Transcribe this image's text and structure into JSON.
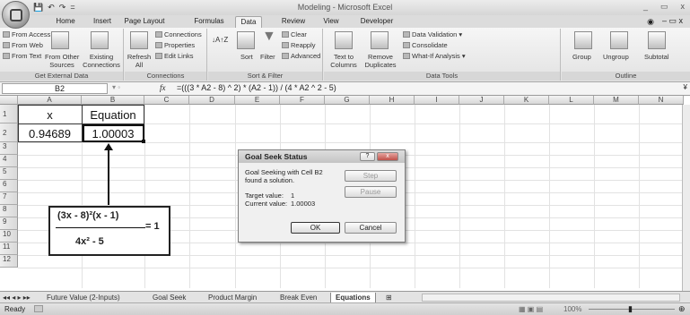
{
  "window": {
    "title": "Modeling - Microsoft Excel",
    "controls": [
      "_",
      "▭",
      "x"
    ]
  },
  "qat": [
    "💾",
    "↶",
    "↷",
    "="
  ],
  "tabs": [
    "Home",
    "Insert",
    "Page Layout",
    "Formulas",
    "Data",
    "Review",
    "View",
    "Developer"
  ],
  "active_tab": "Data",
  "ribbon": {
    "external": {
      "from_access": "From Access",
      "from_web": "From Web",
      "from_text": "From Text",
      "from_other_1": "From Other",
      "from_other_2": "Sources",
      "existing_1": "Existing",
      "existing_2": "Connections",
      "label": "Get External Data"
    },
    "connections": {
      "refresh_1": "Refresh",
      "refresh_2": "All",
      "connections": "Connections",
      "properties": "Properties",
      "edit_links": "Edit Links",
      "label": "Connections"
    },
    "sortfilter": {
      "sort": "Sort",
      "filter": "Filter",
      "clear": "Clear",
      "reapply": "Reapply",
      "advanced": "Advanced",
      "label": "Sort & Filter"
    },
    "datatools": {
      "text_1": "Text to",
      "text_2": "Columns",
      "remove_1": "Remove",
      "remove_2": "Duplicates",
      "validation": "Data Validation",
      "consolidate": "Consolidate",
      "whatif": "What-If Analysis",
      "label": "Data Tools"
    },
    "outline": {
      "group": "Group",
      "ungroup": "Ungroup",
      "subtotal": "Subtotal",
      "label": "Outline"
    }
  },
  "formula_bar": {
    "name_box": "B2",
    "fx": "fx",
    "formula": "=(((3 * A2 - 8) ^ 2) * (A2 - 1)) / (4 * A2 ^ 2 - 5)"
  },
  "columns": [
    "A",
    "B",
    "C",
    "D",
    "E",
    "F",
    "G",
    "H",
    "I",
    "J",
    "K",
    "L",
    "M",
    "N"
  ],
  "rows": [
    "1",
    "2",
    "3",
    "4",
    "5",
    "6",
    "7",
    "8",
    "9",
    "10",
    "11",
    "12"
  ],
  "cells": {
    "a1": "x",
    "b1": "Equation",
    "a2": "0.94689",
    "b2": "1.00003"
  },
  "equation_box": {
    "numerator": "(3x - 8)²(x - 1)",
    "denominator": "4x² - 5",
    "rhs": "= 1"
  },
  "dialog": {
    "title": "Goal Seek Status",
    "help": "?",
    "close": "x",
    "message_1": "Goal Seeking with Cell B2",
    "message_2": "found a solution.",
    "target_label": "Target value:",
    "target_value": "1",
    "current_label": "Current value:",
    "current_value": "1.00003",
    "step": "Step",
    "pause": "Pause",
    "ok": "OK",
    "cancel": "Cancel"
  },
  "sheet_tabs": [
    "Future Value (2-Inputs)",
    "Goal Seek",
    "Product Margin",
    "Break Even",
    "Equations"
  ],
  "active_sheet": "Equations",
  "status": {
    "ready": "Ready",
    "zoom": "100%"
  }
}
